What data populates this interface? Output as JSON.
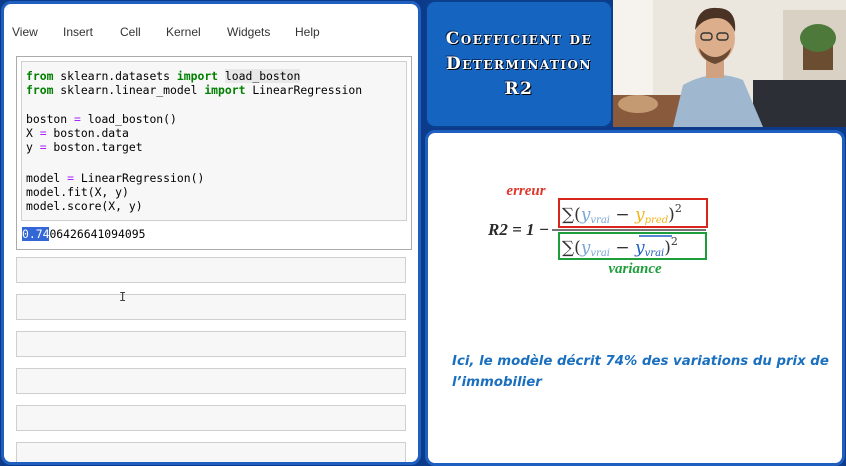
{
  "menu": {
    "items": [
      "View",
      "Insert",
      "Cell",
      "Kernel",
      "Widgets",
      "Help"
    ]
  },
  "code": {
    "line1": {
      "kw1": "from",
      "mid": " sklearn.datasets ",
      "kw2": "import",
      "name": "load_boston"
    },
    "line2": {
      "kw1": "from",
      "mid": " sklearn.linear_model ",
      "kw2": "import",
      "name": " LinearRegression"
    },
    "line3": {
      "lhs": "boston ",
      "op": "=",
      "rhs": " load_boston()"
    },
    "line4": {
      "lhs": "X ",
      "op": "=",
      "rhs": " boston.data"
    },
    "line5": {
      "lhs": "y ",
      "op": "=",
      "rhs": " boston.target"
    },
    "line6": {
      "lhs": "model ",
      "op": "=",
      "rhs": " LinearRegression()"
    },
    "line7": "model.fit(X, y)",
    "line8": "model.score(X, y)"
  },
  "output": {
    "selected": "0.74",
    "rest": "06426641094095"
  },
  "title": {
    "line1": "Coefficient de",
    "line2": "Determination",
    "line3": "R2"
  },
  "formula": {
    "lhs": "R2 = 1 −",
    "numerator_label": "erreur",
    "denominator_label": "variance",
    "sum_symbol": "∑",
    "y": "y",
    "sub_vrai": "vrai",
    "sub_pred": "pred",
    "minus": "−",
    "exp": "2",
    "colors": {
      "erreur": "#d9261c",
      "variance": "#1e9e3a",
      "y_vrai": "#7aa7d6",
      "y_pred": "#f2b51c",
      "y_mean": "#1f5fbf"
    }
  },
  "caption": "Ici, le modèle décrit 74% des variations du prix de l’immobilier",
  "accent": "#1f5fbf"
}
